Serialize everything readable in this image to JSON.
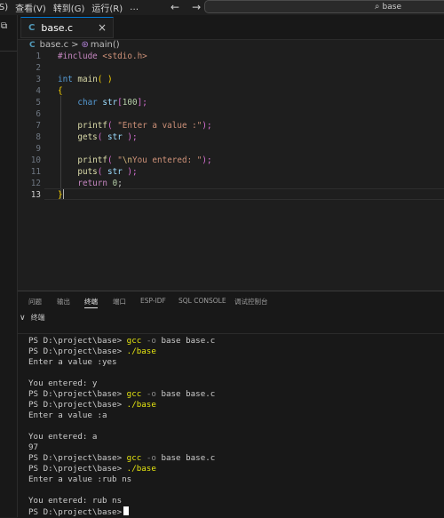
{
  "titlebar": {
    "menus": [
      "(S)",
      "查看(V)",
      "转到(G)",
      "运行(R)",
      "…"
    ],
    "back_icon": "←",
    "forward_icon": "→",
    "search_icon": "⌕",
    "search_text": "base"
  },
  "tab": {
    "label": "base.c",
    "lang_icon": "C",
    "close_icon": "×"
  },
  "breadcrumb": {
    "file": "base.c",
    "sep": ">",
    "symbol_icon": "⊛",
    "symbol": "main()"
  },
  "editor": {
    "line_numbers": [
      "1",
      "2",
      "3",
      "4",
      "5",
      "6",
      "7",
      "8",
      "9",
      "10",
      "11",
      "12",
      "13"
    ],
    "current_line": "13",
    "code": {
      "l1_kw": "#include",
      "l1_header": "<stdio.h>",
      "l3_type": "int",
      "l3_fn": "main",
      "l3_paren": "( )",
      "l4_brace": "{",
      "l5_type": "char",
      "l5_var": "str",
      "l5_lb": "[",
      "l5_num": "100",
      "l5_rb": "];",
      "l7_fn": "printf",
      "l7_open": "(",
      "l7_str": "\"Enter a value :\"",
      "l7_close": ");",
      "l8_fn": "gets",
      "l8_open": "(",
      "l8_var": "str",
      "l8_close": ");",
      "l10_fn": "printf",
      "l10_open": "(",
      "l10_q": "\"",
      "l10_esc": "\\n",
      "l10_str": "You entered: \"",
      "l10_close": ");",
      "l11_fn": "puts",
      "l11_open": "(",
      "l11_var": "str",
      "l11_close": ");",
      "l12_kw": "return",
      "l12_num": "0",
      "l12_semi": ";",
      "l13_brace": "}"
    }
  },
  "panel": {
    "tabs": [
      "问题",
      "输出",
      "终端",
      "端口",
      "ESP-IDF",
      "SQL CONSOLE",
      "调试控制台"
    ],
    "active_tab": "终端",
    "terminal_title": "终端",
    "chevron_icon": "∨",
    "prompt": "PS D:\\project\\base>",
    "cmd_gcc": "gcc",
    "flag_o": "-o",
    "args_compile": "base base.c",
    "cmd_run": "./base",
    "enter": "Enter a value :",
    "input1": "yes",
    "output1": "You entered: y",
    "input2": "a",
    "output2": "You entered: a",
    "extra": "97",
    "input3": "rub ns",
    "output3": "You entered: rub ns"
  }
}
